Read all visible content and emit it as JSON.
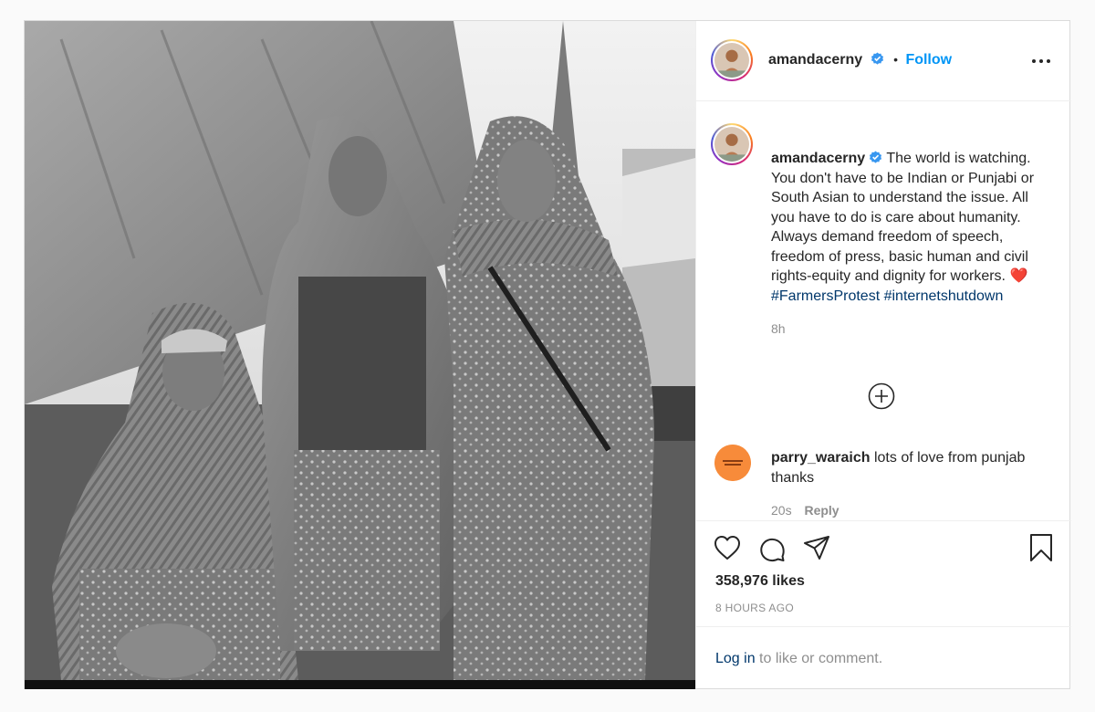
{
  "post": {
    "author": {
      "username": "amandacerny",
      "verified": true
    },
    "follow_label": "Follow",
    "dot": "•",
    "caption": {
      "text": "The world is watching. You don't have to be Indian or Punjabi or South Asian to understand the issue. All you have to do is care about humanity. Always demand freedom of speech, freedom of press, basic human and civil rights-equity and dignity for workers.",
      "emoji": "❤️",
      "hashtags": "#FarmersProtest #internetshutdown",
      "age": "8h"
    },
    "comments": [
      {
        "username": "parry_waraich",
        "text": "lots of love from punjab thanks",
        "age": "20s",
        "reply_label": "Reply"
      }
    ],
    "likes": "358,976 likes",
    "timestamp": "8 HOURS AGO",
    "login": {
      "link": "Log in",
      "rest": " to like or comment."
    }
  },
  "icons": [
    "more-options-icon",
    "verified-badge-icon",
    "load-more-comments-icon",
    "heart-icon",
    "comment-icon",
    "share-icon",
    "bookmark-icon"
  ],
  "colors": {
    "accent": "#0095f6",
    "verified": "#3897f0",
    "heart": "#ed4956",
    "hashtag": "#00376b",
    "muted": "#8e8e8e",
    "border": "#dbdbdb"
  }
}
